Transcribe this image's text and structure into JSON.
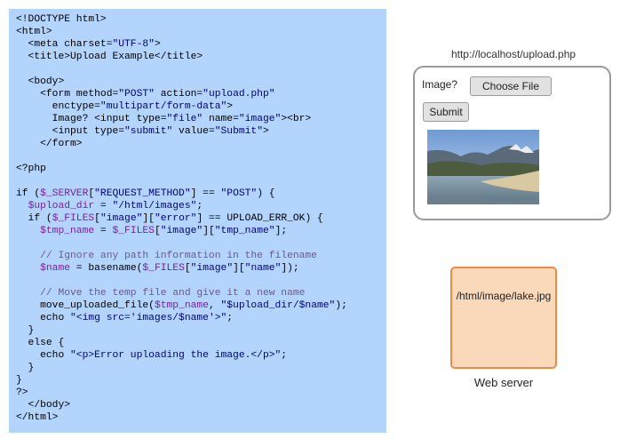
{
  "code": {
    "lines": [
      [
        {
          "t": "<!DOCTYPE html>"
        }
      ],
      [
        {
          "t": "<html>"
        }
      ],
      [
        {
          "t": "  <meta charset="
        },
        {
          "t": "\"UTF-8\"",
          "c": "str"
        },
        {
          "t": ">"
        }
      ],
      [
        {
          "t": "  <title>Upload Example</title>"
        }
      ],
      [
        {
          "t": ""
        }
      ],
      [
        {
          "t": "  <body>"
        }
      ],
      [
        {
          "t": "    <form method="
        },
        {
          "t": "\"POST\"",
          "c": "str"
        },
        {
          "t": " action="
        },
        {
          "t": "\"upload.php\"",
          "c": "str"
        }
      ],
      [
        {
          "t": "      enctype="
        },
        {
          "t": "\"multipart/form-data\"",
          "c": "str"
        },
        {
          "t": ">"
        }
      ],
      [
        {
          "t": "      Image? <input type="
        },
        {
          "t": "\"file\"",
          "c": "str"
        },
        {
          "t": " name="
        },
        {
          "t": "\"image\"",
          "c": "str"
        },
        {
          "t": "><br>"
        }
      ],
      [
        {
          "t": "      <input type="
        },
        {
          "t": "\"submit\"",
          "c": "str"
        },
        {
          "t": " value="
        },
        {
          "t": "\"Submit\"",
          "c": "str"
        },
        {
          "t": ">"
        }
      ],
      [
        {
          "t": "    </form>"
        }
      ],
      [
        {
          "t": ""
        }
      ],
      [
        {
          "t": "<?php"
        }
      ],
      [
        {
          "t": ""
        }
      ],
      [
        {
          "t": "if ("
        },
        {
          "t": "$_SERVER",
          "c": "var"
        },
        {
          "t": "["
        },
        {
          "t": "\"REQUEST_METHOD\"",
          "c": "str"
        },
        {
          "t": "] == "
        },
        {
          "t": "\"POST\"",
          "c": "str"
        },
        {
          "t": ") {"
        }
      ],
      [
        {
          "t": "  "
        },
        {
          "t": "$upload_dir",
          "c": "var"
        },
        {
          "t": " = "
        },
        {
          "t": "\"/html/images\"",
          "c": "str"
        },
        {
          "t": ";"
        }
      ],
      [
        {
          "t": "  if ("
        },
        {
          "t": "$_FILES",
          "c": "var"
        },
        {
          "t": "["
        },
        {
          "t": "\"image\"",
          "c": "str"
        },
        {
          "t": "]["
        },
        {
          "t": "\"error\"",
          "c": "str"
        },
        {
          "t": "] == UPLOAD_ERR_OK) {"
        }
      ],
      [
        {
          "t": "    "
        },
        {
          "t": "$tmp_name",
          "c": "var"
        },
        {
          "t": " = "
        },
        {
          "t": "$_FILES",
          "c": "var"
        },
        {
          "t": "["
        },
        {
          "t": "\"image\"",
          "c": "str"
        },
        {
          "t": "]["
        },
        {
          "t": "\"tmp_name\"",
          "c": "str"
        },
        {
          "t": "];"
        }
      ],
      [
        {
          "t": ""
        }
      ],
      [
        {
          "t": "    // Ignore any path information in the filename",
          "c": "cmt"
        }
      ],
      [
        {
          "t": "    "
        },
        {
          "t": "$name",
          "c": "var"
        },
        {
          "t": " = basename("
        },
        {
          "t": "$_FILES",
          "c": "var"
        },
        {
          "t": "["
        },
        {
          "t": "\"image\"",
          "c": "str"
        },
        {
          "t": "]["
        },
        {
          "t": "\"name\"",
          "c": "str"
        },
        {
          "t": "]);"
        }
      ],
      [
        {
          "t": ""
        }
      ],
      [
        {
          "t": "    // Move the temp file and give it a new name",
          "c": "cmt"
        }
      ],
      [
        {
          "t": "    move_uploaded_file("
        },
        {
          "t": "$tmp_name",
          "c": "var"
        },
        {
          "t": ", "
        },
        {
          "t": "\"$upload_dir/$name\"",
          "c": "str"
        },
        {
          "t": ");"
        }
      ],
      [
        {
          "t": "    echo "
        },
        {
          "t": "\"<img src='images/$name'>\"",
          "c": "str"
        },
        {
          "t": ";"
        }
      ],
      [
        {
          "t": "  }"
        }
      ],
      [
        {
          "t": "  else {"
        }
      ],
      [
        {
          "t": "    echo "
        },
        {
          "t": "\"<p>Error uploading the image.</p>\"",
          "c": "str"
        },
        {
          "t": ";"
        }
      ],
      [
        {
          "t": "  }"
        }
      ],
      [
        {
          "t": "}"
        }
      ],
      [
        {
          "t": "?>"
        }
      ],
      [
        {
          "t": "  </body>"
        }
      ],
      [
        {
          "t": "</html>"
        }
      ]
    ]
  },
  "browser": {
    "url": "http://localhost/upload.php",
    "image_label": "Image?",
    "choose_file_label": "Choose File",
    "submit_label": "Submit",
    "photo_icon": "lake-landscape-photo"
  },
  "server": {
    "file_path": "/html/image/lake.jpg",
    "label": "Web server",
    "fill_color": "#fad9bb",
    "border_color": "#ee8a45"
  }
}
